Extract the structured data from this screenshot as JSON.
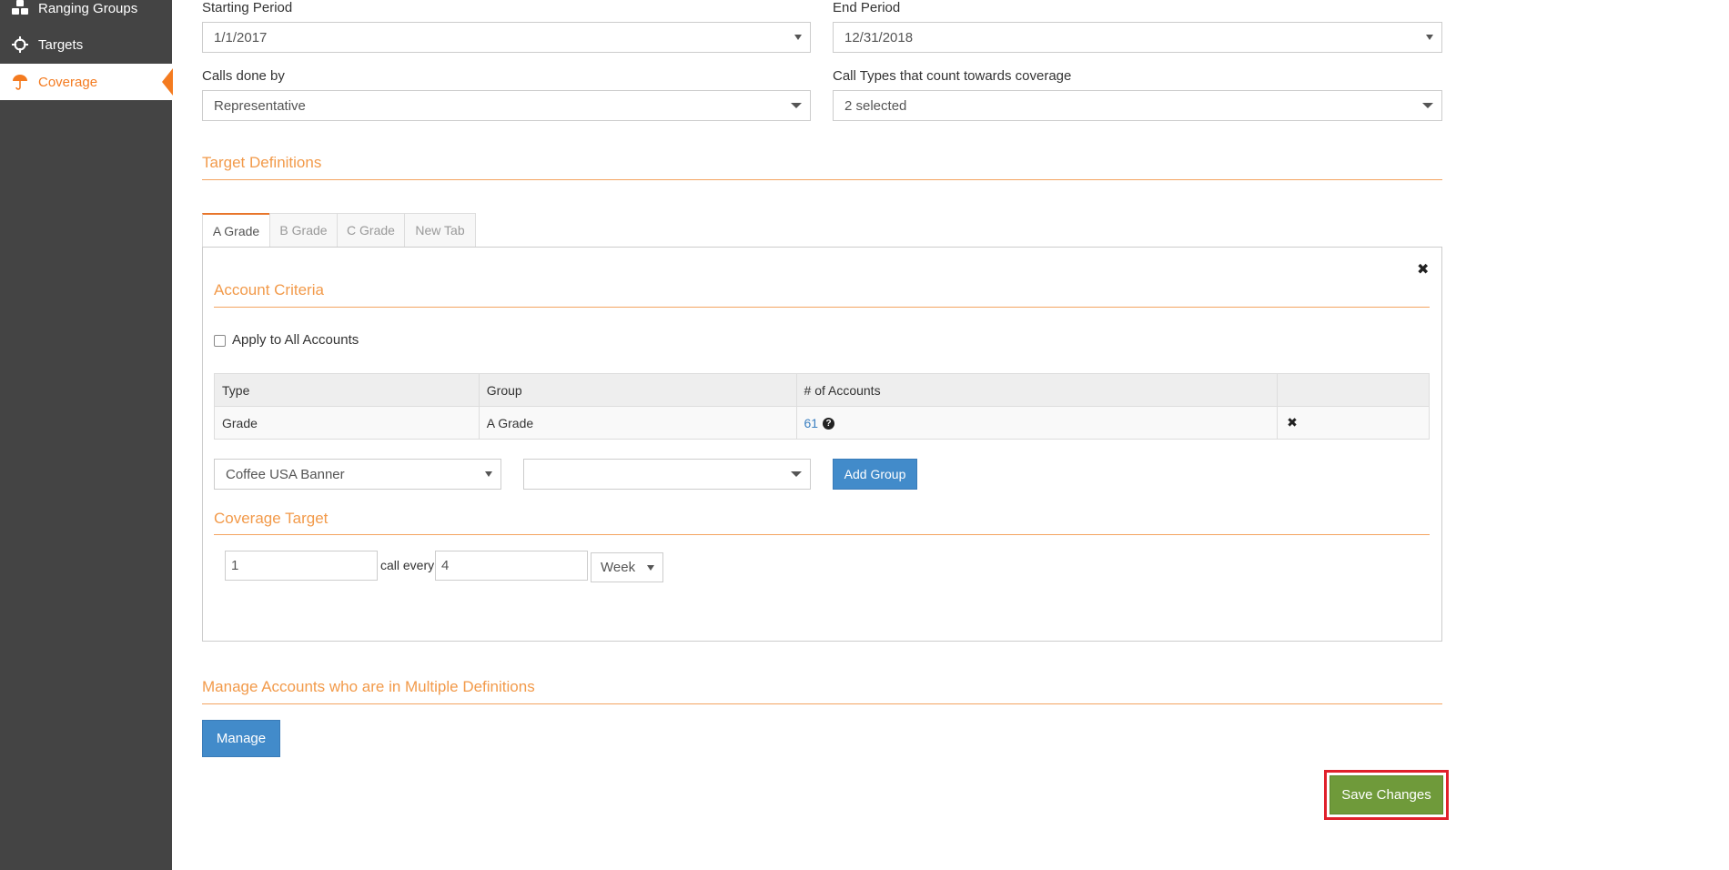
{
  "sidebar": {
    "items": [
      {
        "label": "Ranging Groups",
        "icon": "cubes-icon"
      },
      {
        "label": "Targets",
        "icon": "crosshair-icon"
      },
      {
        "label": "Coverage",
        "icon": "umbrella-icon",
        "active": true
      }
    ]
  },
  "period": {
    "start_label": "Starting Period",
    "start_value": "1/1/2017",
    "end_label": "End Period",
    "end_value": "12/31/2018"
  },
  "calls": {
    "done_by_label": "Calls done by",
    "done_by_value": "Representative",
    "types_label": "Call Types that count towards coverage",
    "types_value": "2 selected"
  },
  "target_definitions": {
    "title": "Target Definitions",
    "tabs": [
      "A Grade",
      "B Grade",
      "C Grade",
      "New Tab"
    ],
    "active_tab": "A Grade"
  },
  "account_criteria": {
    "title": "Account Criteria",
    "apply_all_label": "Apply to All Accounts",
    "apply_all_checked": false,
    "table": {
      "headers": [
        "Type",
        "Group",
        "# of Accounts",
        ""
      ],
      "rows": [
        {
          "type": "Grade",
          "group": "A Grade",
          "accounts": "61"
        }
      ]
    },
    "type_select_value": "Coffee USA Banner",
    "group_select_value": "",
    "add_group_label": "Add Group"
  },
  "coverage_target": {
    "title": "Coverage Target",
    "calls_value": "1",
    "call_every_label": "call every",
    "interval_value": "4",
    "unit_value": "Week"
  },
  "manage": {
    "title": "Manage Accounts who are in Multiple Definitions",
    "button_label": "Manage"
  },
  "save_label": "Save Changes",
  "colors": {
    "accent": "#f47b20",
    "sidebar_bg": "#444444",
    "primary_btn": "#428bca",
    "save_btn": "#6f9a3a",
    "highlight_border": "#e0202b"
  }
}
